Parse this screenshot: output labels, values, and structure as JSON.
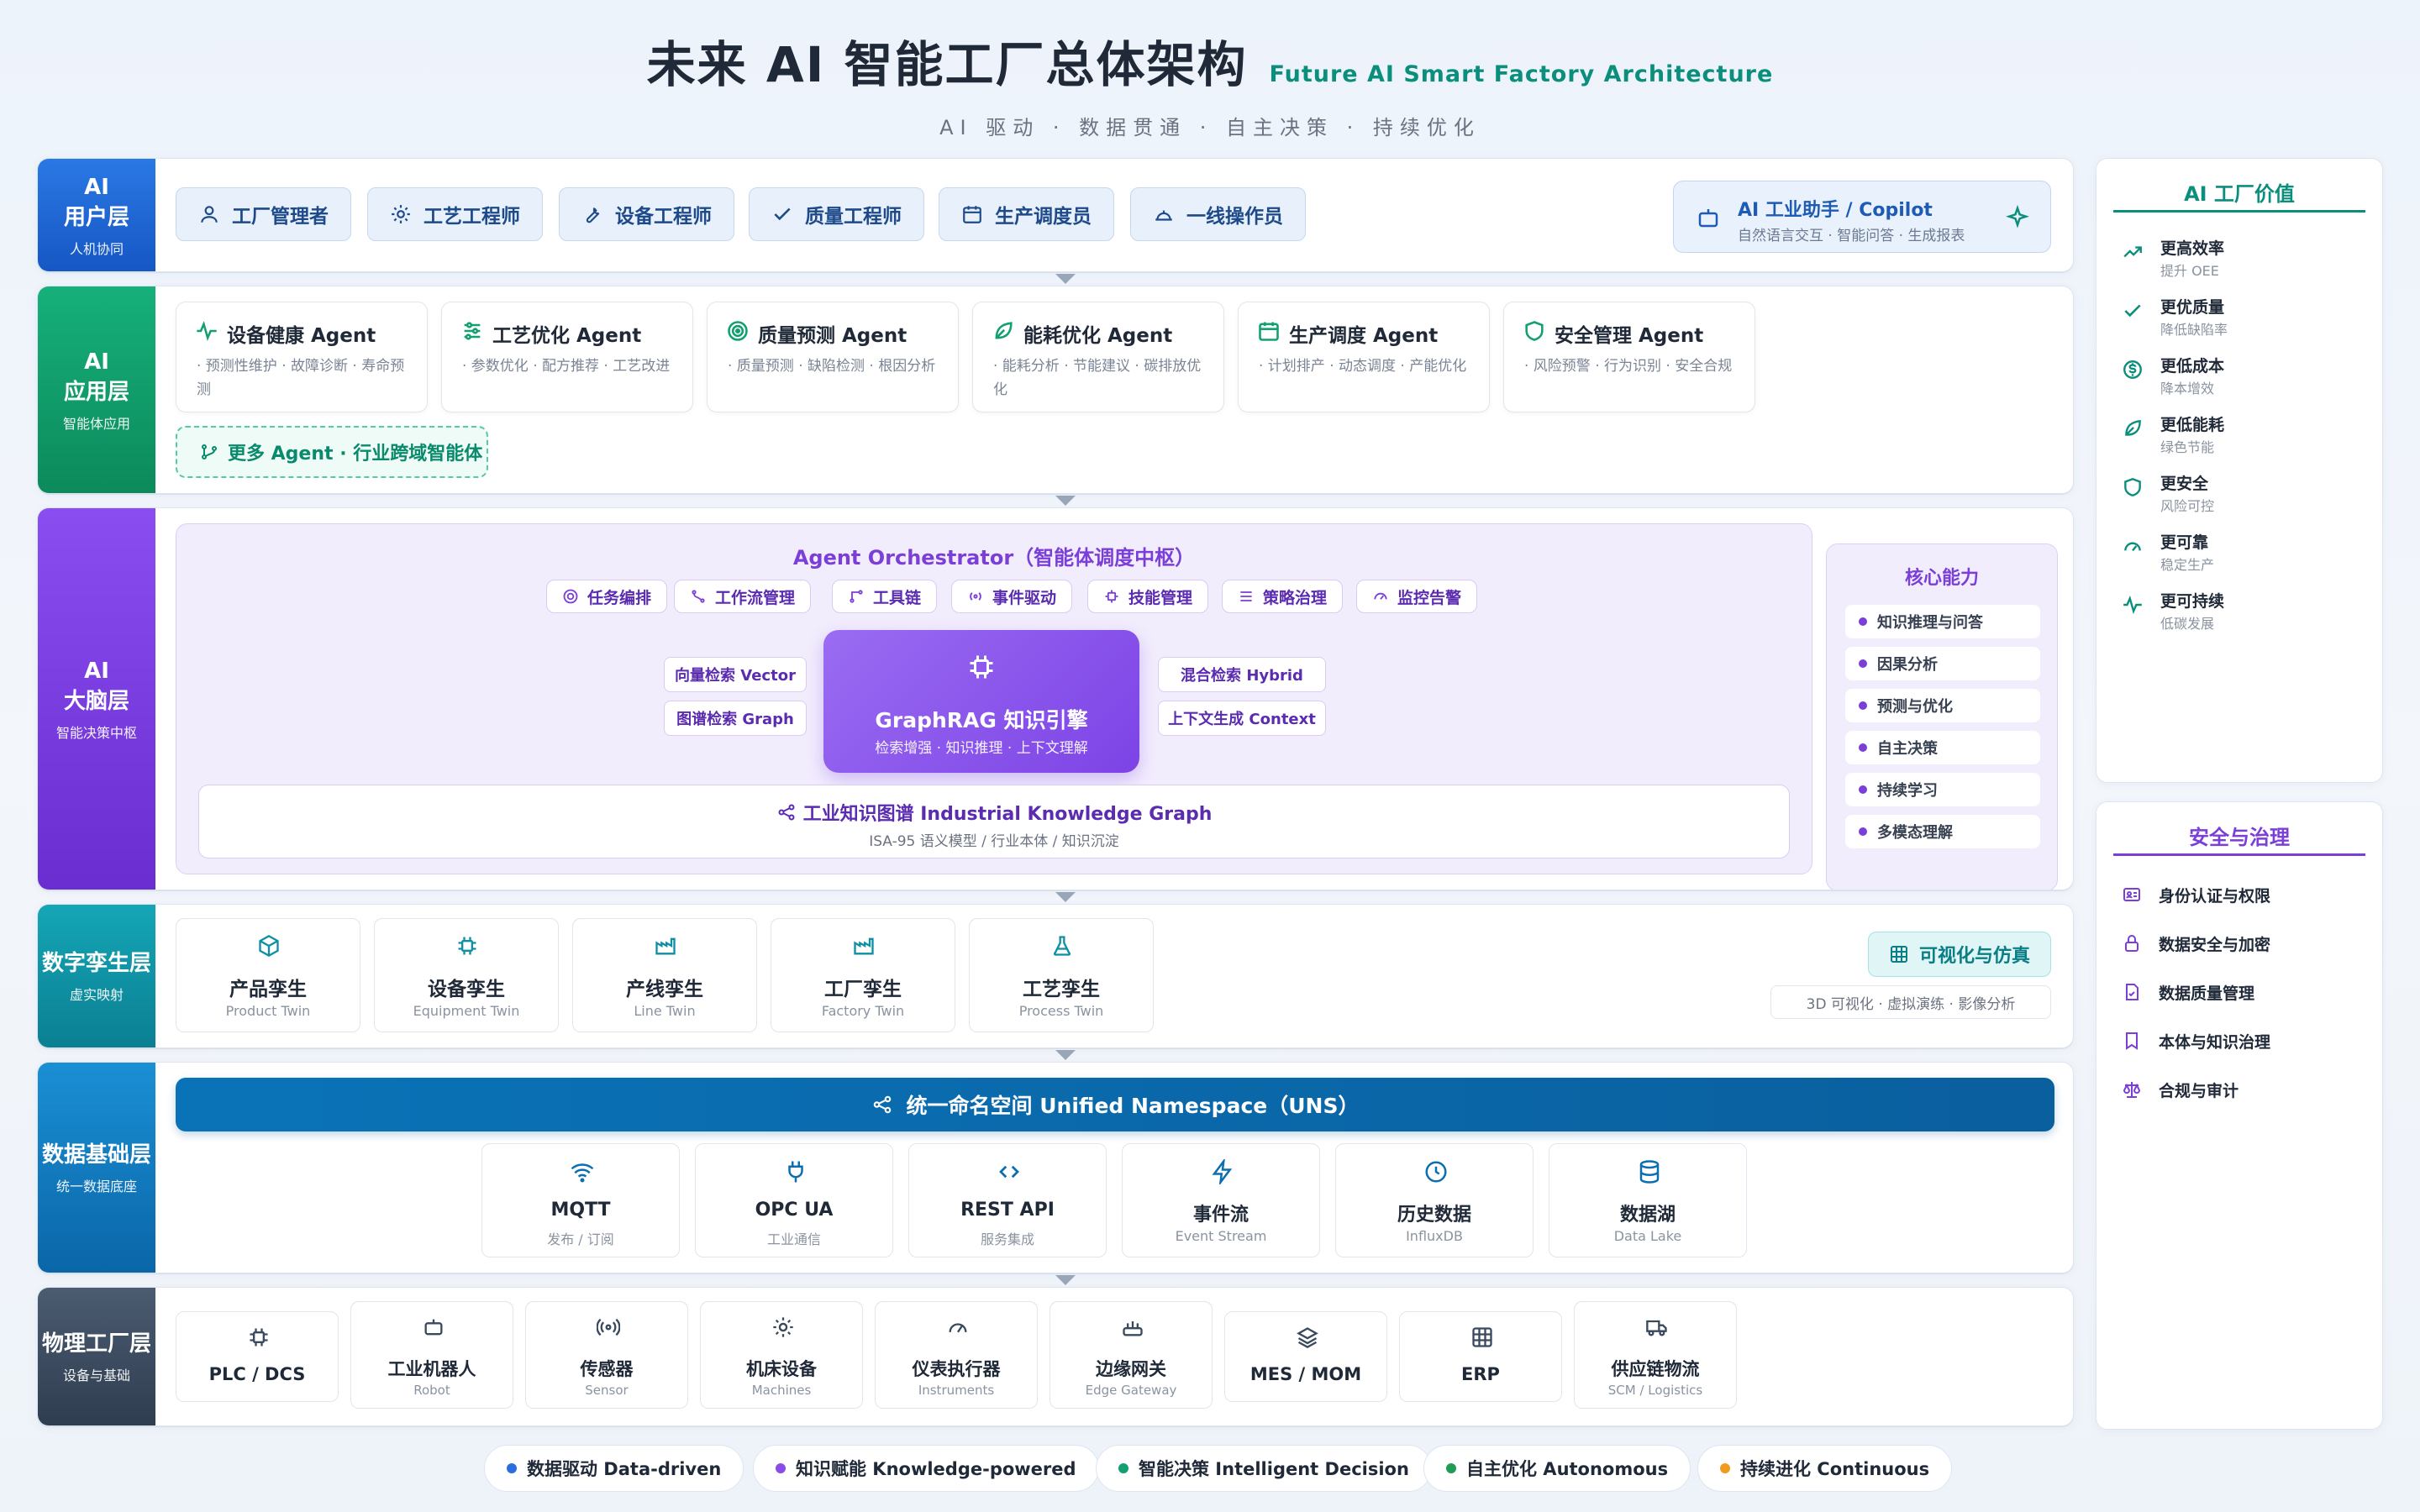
{
  "header": {
    "title_zh": "未来 AI 智能工厂总体架构",
    "title_en": "Future AI Smart Factory Architecture",
    "subtitle": "AI 驱动 · 数据贯通 · 自主决策 · 持续优化"
  },
  "colors": {
    "user_layer": "#1b66d6",
    "app_layer": "#12a06f",
    "brain_layer": "#7a3de0",
    "twin_layer": "#0e8fa3",
    "data_layer": "#0a6eb0",
    "physical_layer": "#3a4a5e",
    "accent_purple": "#7b3fd8",
    "accent_green": "#0b8f7c"
  },
  "layers": {
    "user": {
      "label": "AI",
      "label2": "用户层",
      "sub": "人机协同",
      "roles": [
        "工厂管理者",
        "工艺工程师",
        "设备工程师",
        "质量工程师",
        "生产调度员",
        "一线操作员"
      ],
      "role_icons": [
        "user-icon",
        "gear-icon",
        "wrench-icon",
        "check-icon",
        "calendar-icon",
        "helmet-icon"
      ],
      "copilot": {
        "title": "AI 工业助手 / Copilot",
        "sub": "自然语言交互 · 智能问答 · 生成报表"
      }
    },
    "app": {
      "label": "AI",
      "label2": "应用层",
      "sub": "智能体应用",
      "agents": [
        {
          "title": "设备健康 Agent",
          "desc": "· 预测性维护 · 故障诊断 · 寿命预测",
          "icon": "pulse-icon"
        },
        {
          "title": "工艺优化 Agent",
          "desc": "· 参数优化 · 配方推荐 · 工艺改进",
          "icon": "sliders-icon"
        },
        {
          "title": "质量预测 Agent",
          "desc": "· 质量预测 · 缺陷检测 · 根因分析",
          "icon": "target-icon"
        },
        {
          "title": "能耗优化 Agent",
          "desc": "· 能耗分析 · 节能建议 · 碳排放优化",
          "icon": "leaf-icon"
        },
        {
          "title": "生产调度 Agent",
          "desc": "· 计划排产 · 动态调度 · 产能优化",
          "icon": "calendar-icon"
        },
        {
          "title": "安全管理 Agent",
          "desc": "· 风险预警 · 行为识别 · 安全合规",
          "icon": "shield-icon"
        }
      ],
      "more": "更多 Agent · 行业跨域智能体"
    },
    "brain": {
      "label": "AI",
      "label2": "大脑层",
      "sub": "智能决策中枢",
      "orchestrator": "Agent Orchestrator（智能体调度中枢）",
      "pills": [
        "任务编排",
        "工作流管理",
        "工具链",
        "事件驱动",
        "技能管理",
        "策略治理",
        "监控告警"
      ],
      "retrieval_left": [
        "向量检索 Vector",
        "图谱检索 Graph"
      ],
      "retrieval_right": [
        "混合检索 Hybrid",
        "上下文生成 Context"
      ],
      "engine": {
        "title": "GraphRAG 知识引擎",
        "sub": "检索增强 · 知识推理 · 上下文理解"
      },
      "kg": {
        "title": "工业知识图谱 Industrial Knowledge Graph",
        "sub": "ISA-95 语义模型 / 行业本体 / 知识沉淀"
      },
      "core": {
        "title": "核心能力",
        "items": [
          "知识推理与问答",
          "因果分析",
          "预测与优化",
          "自主决策",
          "持续学习",
          "多模态理解"
        ]
      }
    },
    "twin": {
      "label": "数字孪生层",
      "sub": "虚实映射",
      "items": [
        {
          "title": "产品孪生",
          "sub": "Product Twin",
          "icon": "cube-icon"
        },
        {
          "title": "设备孪生",
          "sub": "Equipment Twin",
          "icon": "chip-icon"
        },
        {
          "title": "产线孪生",
          "sub": "Line Twin",
          "icon": "factory-icon"
        },
        {
          "title": "工厂孪生",
          "sub": "Factory Twin",
          "icon": "factory-icon"
        },
        {
          "title": "工艺孪生",
          "sub": "Process Twin",
          "icon": "flask-icon"
        }
      ],
      "viz": "可视化与仿真",
      "viz_sub": "3D 可视化 · 虚拟演练 · 影像分析"
    },
    "data": {
      "label": "数据基础层",
      "sub": "统一数据底座",
      "uns": "统一命名空间 Unified Namespace（UNS）",
      "protocols": [
        {
          "title": "MQTT",
          "sub": "发布 / 订阅",
          "icon": "wifi-icon"
        },
        {
          "title": "OPC UA",
          "sub": "工业通信",
          "icon": "plug-icon"
        },
        {
          "title": "REST API",
          "sub": "服务集成",
          "icon": "code-icon"
        },
        {
          "title": "事件流",
          "sub": "Event Stream",
          "icon": "bolt-icon"
        },
        {
          "title": "历史数据",
          "sub": "InfluxDB",
          "icon": "clock-icon"
        },
        {
          "title": "数据湖",
          "sub": "Data Lake",
          "icon": "database-icon"
        }
      ]
    },
    "physical": {
      "label": "物理工厂层",
      "sub": "设备与基础",
      "devices": [
        {
          "title": "PLC / DCS",
          "sub": "",
          "icon": "chip-icon"
        },
        {
          "title": "工业机器人",
          "sub": "Robot",
          "icon": "robot-icon"
        },
        {
          "title": "传感器",
          "sub": "Sensor",
          "icon": "signal-icon"
        },
        {
          "title": "机床设备",
          "sub": "Machines",
          "icon": "gear-icon"
        },
        {
          "title": "仪表执行器",
          "sub": "Instruments",
          "icon": "gauge-icon"
        },
        {
          "title": "边缘网关",
          "sub": "Edge Gateway",
          "icon": "router-icon"
        },
        {
          "title": "MES / MOM",
          "sub": "",
          "icon": "layers-icon"
        },
        {
          "title": "ERP",
          "sub": "",
          "icon": "grid-icon"
        },
        {
          "title": "供应链物流",
          "sub": "SCM / Logistics",
          "icon": "truck-icon"
        }
      ]
    }
  },
  "value_panel": {
    "title": "AI 工厂价值",
    "items": [
      {
        "title": "更高效率",
        "sub": "提升 OEE",
        "icon": "trend-up-icon"
      },
      {
        "title": "更优质量",
        "sub": "降低缺陷率",
        "icon": "check-icon"
      },
      {
        "title": "更低成本",
        "sub": "降本增效",
        "icon": "dollar-icon"
      },
      {
        "title": "更低能耗",
        "sub": "绿色节能",
        "icon": "leaf-icon"
      },
      {
        "title": "更安全",
        "sub": "风险可控",
        "icon": "shield-icon"
      },
      {
        "title": "更可靠",
        "sub": "稳定生产",
        "icon": "gauge-icon"
      },
      {
        "title": "更可持续",
        "sub": "低碳发展",
        "icon": "pulse-icon"
      }
    ]
  },
  "gov_panel": {
    "title": "安全与治理",
    "items": [
      "身份认证与权限",
      "数据安全与加密",
      "数据质量管理",
      "本体与知识治理",
      "合规与审计"
    ],
    "icons": [
      "id-card-icon",
      "lock-icon",
      "file-check-icon",
      "bookmark-icon",
      "scale-icon"
    ]
  },
  "legend": [
    {
      "label": "数据驱动 Data-driven",
      "color": "#2b6de0"
    },
    {
      "label": "知识赋能 Knowledge-powered",
      "color": "#8a4be8"
    },
    {
      "label": "智能决策 Intelligent Decision",
      "color": "#12a06f"
    },
    {
      "label": "自主优化 Autonomous",
      "color": "#1f9d55"
    },
    {
      "label": "持续进化 Continuous",
      "color": "#f29a1f"
    }
  ]
}
